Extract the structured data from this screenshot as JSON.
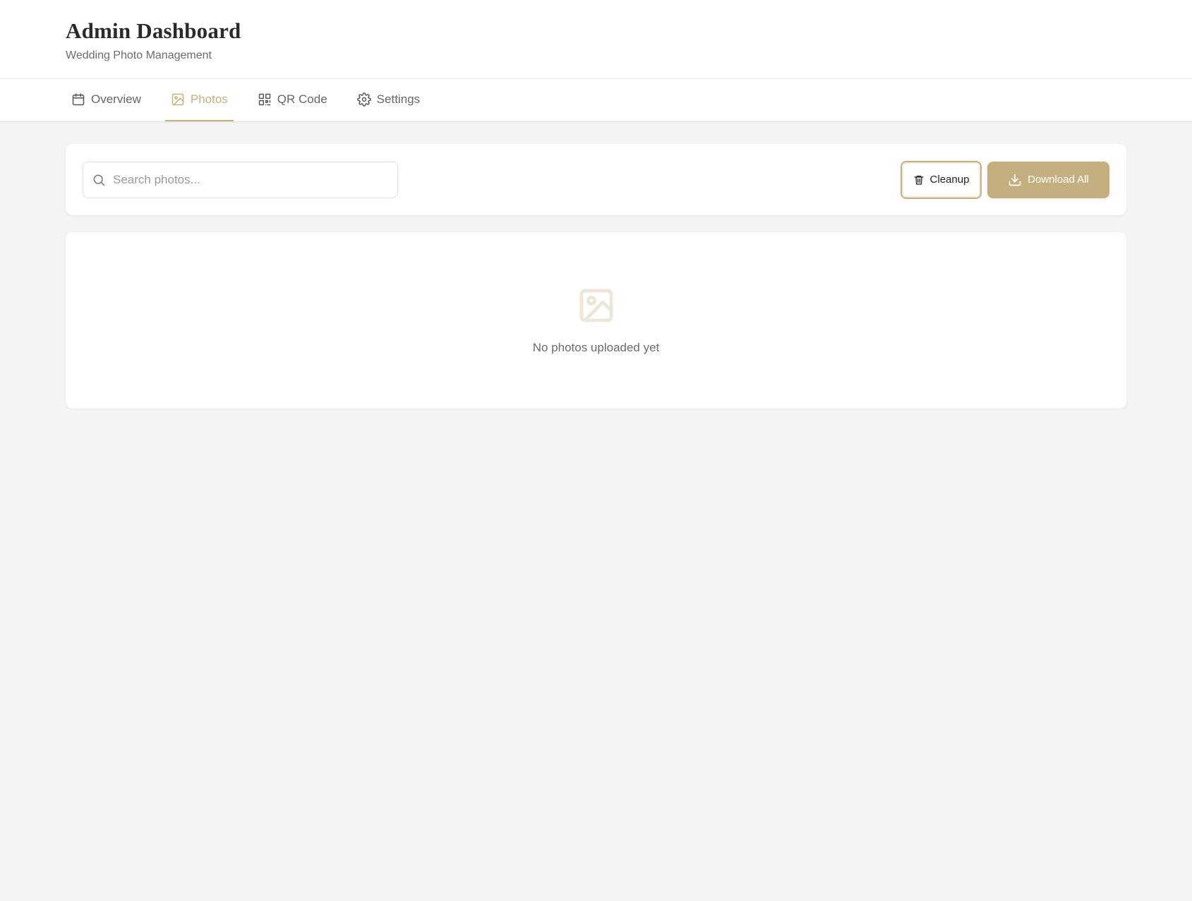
{
  "header": {
    "title": "Admin Dashboard",
    "subtitle": "Wedding Photo Management"
  },
  "tabs": [
    {
      "label": "Overview",
      "icon": "calendar-icon",
      "active": false
    },
    {
      "label": "Photos",
      "icon": "image-icon",
      "active": true
    },
    {
      "label": "QR Code",
      "icon": "qr-code-icon",
      "active": false
    },
    {
      "label": "Settings",
      "icon": "gear-icon",
      "active": false
    }
  ],
  "toolbar": {
    "search_placeholder": "Search photos...",
    "search_value": "",
    "cleanup_label": "Cleanup",
    "download_label": "Download All"
  },
  "empty_state": {
    "message": "No photos uploaded yet",
    "icon": "image-icon"
  },
  "colors": {
    "accent": "#c4b07e",
    "background": "#f4f4f4",
    "card": "#ffffff"
  }
}
